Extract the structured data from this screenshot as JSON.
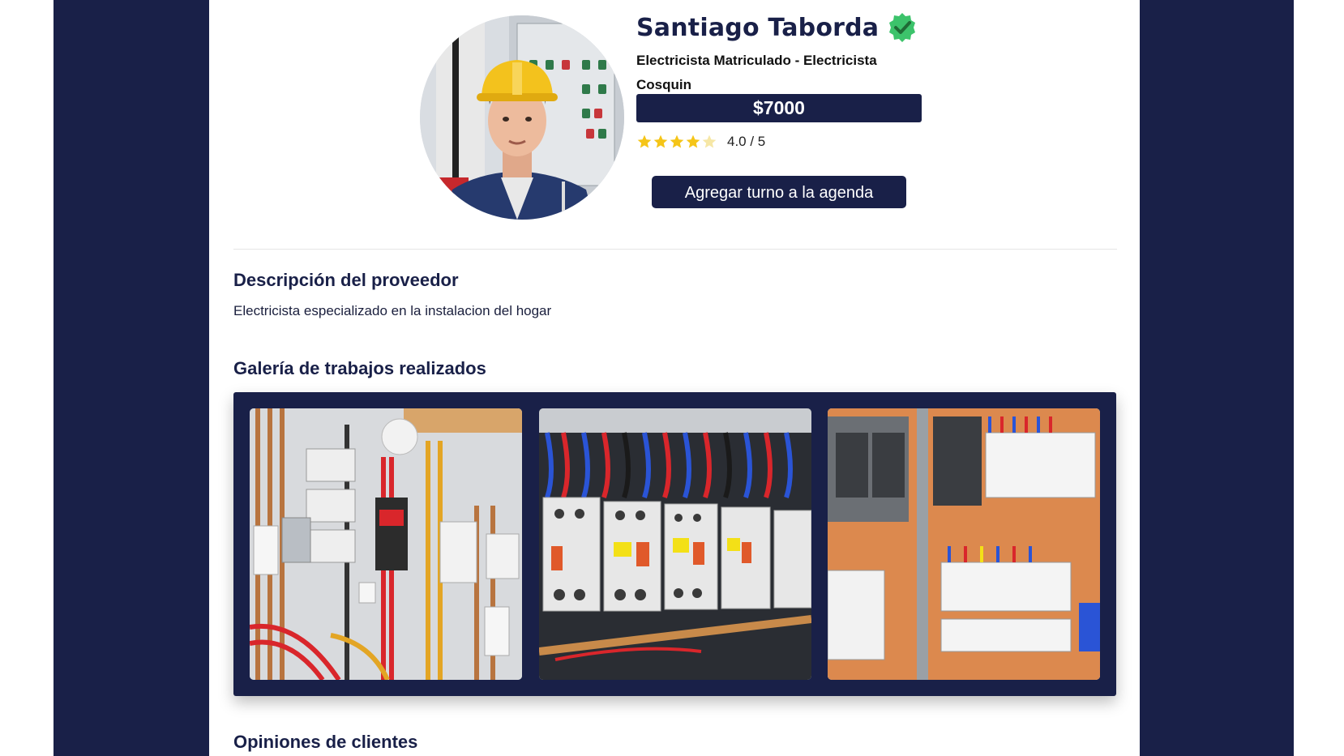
{
  "provider": {
    "name": "Santiago Taborda",
    "title_line1": "Electricista Matriculado - Electricista",
    "title_line2": "Cosquin",
    "price": "$7000",
    "rating": 4.0,
    "rating_text": "4.0 / 5",
    "agenda_button_label": "Agregar turno a la agenda",
    "avatar_icon": "electrician-portrait",
    "verified_icon": "verified-badge-icon"
  },
  "description": {
    "heading": "Descripción del proveedor",
    "text": "Electricista especializado en la instalacion del hogar"
  },
  "gallery": {
    "heading": "Galería de trabajos realizados",
    "items": [
      {
        "icon": "wiring-panel-photo"
      },
      {
        "icon": "contactors-photo"
      },
      {
        "icon": "switchboard-photo"
      }
    ]
  },
  "reviews": {
    "heading": "Opiniones de clientes"
  },
  "colors": {
    "brand_navy": "#192048",
    "star_gold": "#f5c518",
    "verified_green": "#3cc36b"
  }
}
